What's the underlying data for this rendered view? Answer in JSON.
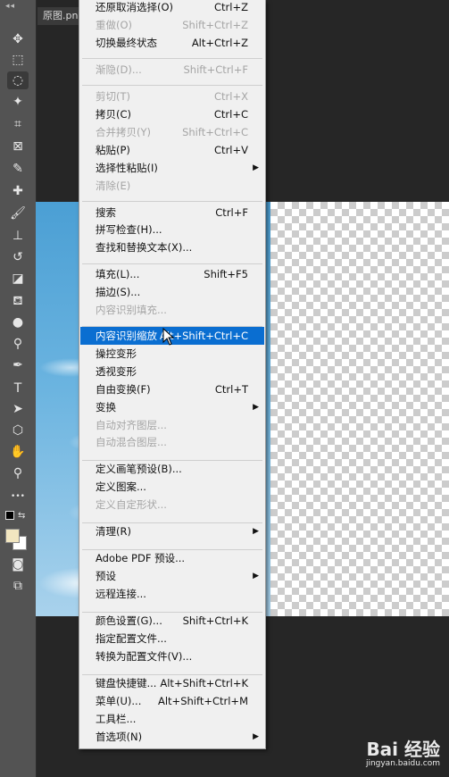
{
  "document": {
    "tab_title": "原图.pn"
  },
  "tools": [
    {
      "name": "move-tool-icon",
      "glyph": "✥"
    },
    {
      "name": "marquee-tool-icon",
      "glyph": "⬚"
    },
    {
      "name": "lasso-tool-icon",
      "glyph": "◌"
    },
    {
      "name": "magic-wand-tool-icon",
      "glyph": "✦"
    },
    {
      "name": "crop-tool-icon",
      "glyph": "⌗"
    },
    {
      "name": "frame-tool-icon",
      "glyph": "⊠"
    },
    {
      "name": "eyedropper-tool-icon",
      "glyph": "✎"
    },
    {
      "name": "healing-brush-tool-icon",
      "glyph": "✚"
    },
    {
      "name": "brush-tool-icon",
      "glyph": "🖌"
    },
    {
      "name": "clone-stamp-tool-icon",
      "glyph": "⊥"
    },
    {
      "name": "history-brush-tool-icon",
      "glyph": "↺"
    },
    {
      "name": "eraser-tool-icon",
      "glyph": "◪"
    },
    {
      "name": "paint-bucket-tool-icon",
      "glyph": "⛾"
    },
    {
      "name": "blur-tool-icon",
      "glyph": "●"
    },
    {
      "name": "dodge-tool-icon",
      "glyph": "⚲"
    },
    {
      "name": "pen-tool-icon",
      "glyph": "✒"
    },
    {
      "name": "type-tool-icon",
      "glyph": "T"
    },
    {
      "name": "path-selection-tool-icon",
      "glyph": "➤"
    },
    {
      "name": "shape-tool-icon",
      "glyph": "⬡"
    },
    {
      "name": "hand-tool-icon",
      "glyph": "✋"
    },
    {
      "name": "zoom-tool-icon",
      "glyph": "⚲"
    },
    {
      "name": "more-tools-icon",
      "glyph": "•••"
    },
    {
      "name": "quick-mask-icon",
      "glyph": "◙"
    },
    {
      "name": "screen-mode-icon",
      "glyph": "⧉"
    }
  ],
  "menu": {
    "items": [
      {
        "label": "还原取消选择(O)",
        "shortcut": "Ctrl+Z",
        "disabled": false
      },
      {
        "label": "重做(O)",
        "shortcut": "Shift+Ctrl+Z",
        "disabled": true
      },
      {
        "label": "切换最终状态",
        "shortcut": "Alt+Ctrl+Z",
        "disabled": false
      },
      {
        "label": "渐隐(D)...",
        "shortcut": "Shift+Ctrl+F",
        "disabled": true
      },
      {
        "label": "剪切(T)",
        "shortcut": "Ctrl+X",
        "disabled": true
      },
      {
        "label": "拷贝(C)",
        "shortcut": "Ctrl+C",
        "disabled": false
      },
      {
        "label": "合并拷贝(Y)",
        "shortcut": "Shift+Ctrl+C",
        "disabled": true
      },
      {
        "label": "粘贴(P)",
        "shortcut": "Ctrl+V",
        "disabled": false
      },
      {
        "label": "选择性粘贴(I)",
        "shortcut": "",
        "disabled": false,
        "submenu": true
      },
      {
        "label": "清除(E)",
        "shortcut": "",
        "disabled": true
      },
      {
        "label": "搜索",
        "shortcut": "Ctrl+F",
        "disabled": false
      },
      {
        "label": "拼写检查(H)...",
        "shortcut": "",
        "disabled": false
      },
      {
        "label": "查找和替换文本(X)...",
        "shortcut": "",
        "disabled": false
      },
      {
        "label": "填充(L)...",
        "shortcut": "Shift+F5",
        "disabled": false
      },
      {
        "label": "描边(S)...",
        "shortcut": "",
        "disabled": false
      },
      {
        "label": "内容识别填充...",
        "shortcut": "",
        "disabled": true
      },
      {
        "label": "内容识别缩放",
        "shortcut": "Alt+Shift+Ctrl+C",
        "disabled": false,
        "highlighted": true
      },
      {
        "label": "操控变形",
        "shortcut": "",
        "disabled": false
      },
      {
        "label": "透视变形",
        "shortcut": "",
        "disabled": false
      },
      {
        "label": "自由变换(F)",
        "shortcut": "Ctrl+T",
        "disabled": false
      },
      {
        "label": "变换",
        "shortcut": "",
        "disabled": false,
        "submenu": true
      },
      {
        "label": "自动对齐图层...",
        "shortcut": "",
        "disabled": true
      },
      {
        "label": "自动混合图层...",
        "shortcut": "",
        "disabled": true
      },
      {
        "label": "定义画笔预设(B)...",
        "shortcut": "",
        "disabled": false
      },
      {
        "label": "定义图案...",
        "shortcut": "",
        "disabled": false
      },
      {
        "label": "定义自定形状...",
        "shortcut": "",
        "disabled": true
      },
      {
        "label": "清理(R)",
        "shortcut": "",
        "disabled": false,
        "submenu": true
      },
      {
        "label": "Adobe PDF 预设...",
        "shortcut": "",
        "disabled": false
      },
      {
        "label": "预设",
        "shortcut": "",
        "disabled": false,
        "submenu": true
      },
      {
        "label": "远程连接...",
        "shortcut": "",
        "disabled": false
      },
      {
        "label": "颜色设置(G)...",
        "shortcut": "Shift+Ctrl+K",
        "disabled": false
      },
      {
        "label": "指定配置文件...",
        "shortcut": "",
        "disabled": false
      },
      {
        "label": "转换为配置文件(V)...",
        "shortcut": "",
        "disabled": false
      },
      {
        "label": "键盘快捷键...",
        "shortcut": "Alt+Shift+Ctrl+K",
        "disabled": false
      },
      {
        "label": "菜单(U)...",
        "shortcut": "Alt+Shift+Ctrl+M",
        "disabled": false
      },
      {
        "label": "工具栏...",
        "shortcut": "",
        "disabled": false
      },
      {
        "label": "首选项(N)",
        "shortcut": "",
        "disabled": false,
        "submenu": true
      }
    ],
    "submenu_glyph": "▶"
  },
  "watermark": {
    "logo": "Bai 经验",
    "url": "jingyan.baidu.com"
  },
  "colors": {
    "highlight": "#0a6ed1",
    "menu_bg": "#f0f0f0",
    "workspace": "#262626",
    "toolbar": "#535353"
  }
}
